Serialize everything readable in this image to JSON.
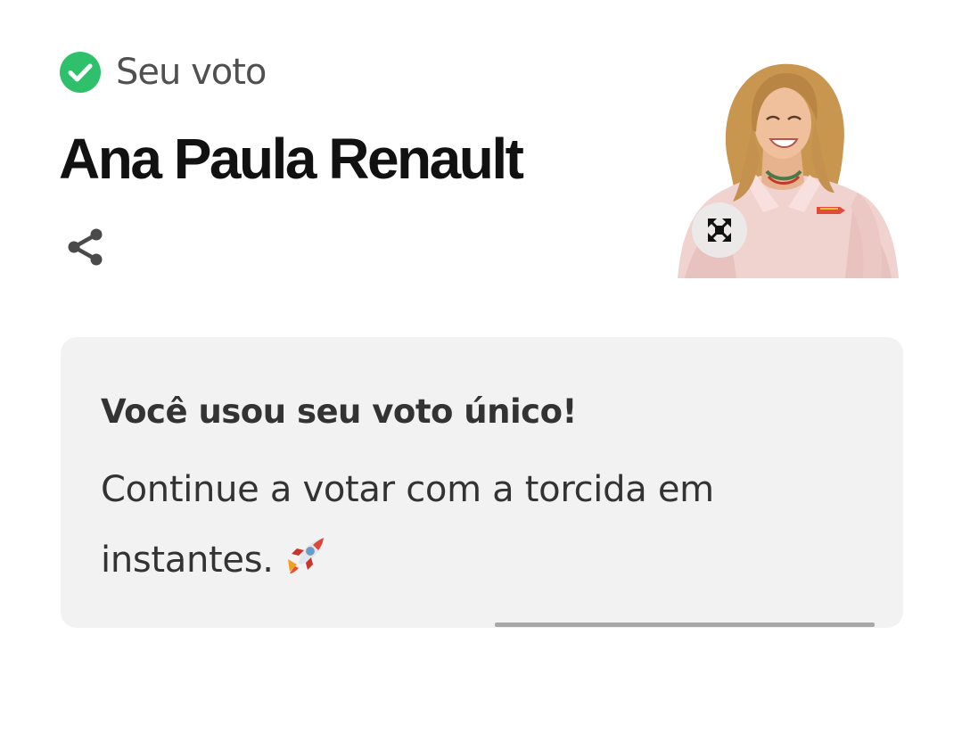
{
  "vote_status": {
    "icon": "check-circle-icon",
    "label": "Seu voto",
    "icon_color": "#2fc06b"
  },
  "candidate": {
    "name": "Ana Paula Renault",
    "photo_alt": "Ana Paula Renault",
    "share_icon": "share-icon",
    "expand_icon": "expand-icon"
  },
  "card": {
    "title": "Você usou seu voto único!",
    "message": "Continue a votar com a torcida em instantes.",
    "emoji_icon": "rocket-icon",
    "progress": 1.0,
    "background": "#f2f2f2"
  }
}
